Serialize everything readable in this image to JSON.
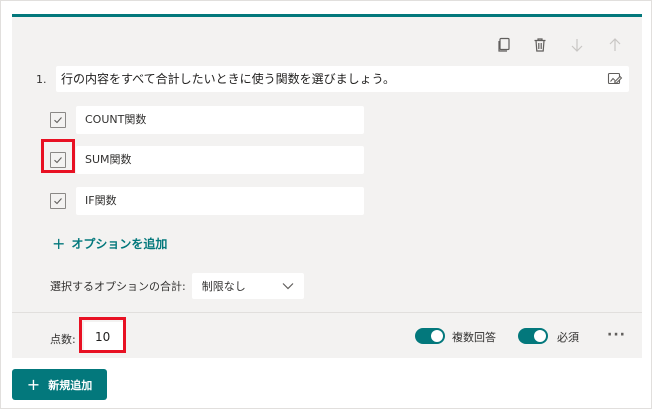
{
  "question": {
    "number": "1.",
    "title": "行の内容をすべて合計したいときに使う関数を選びましょう。"
  },
  "options": [
    {
      "label": "COUNT関数",
      "checked": true
    },
    {
      "label": "SUM関数",
      "checked": true
    },
    {
      "label": "IF関数",
      "checked": true
    }
  ],
  "add_option": {
    "label": "オプションを追加",
    "icon": "plus-icon"
  },
  "selection_total": {
    "label": "選択するオプションの合計:",
    "value": "制限なし"
  },
  "footer": {
    "points_label": "点数:",
    "points_value": "10",
    "multiple_answers_label": "複数回答",
    "multiple_answers_on": true,
    "required_label": "必須",
    "required_on": true,
    "more_icon": "more-icon"
  },
  "new_button": {
    "label": "新規追加",
    "icon": "plus-icon"
  },
  "toolbar_icons": [
    "copy-icon",
    "trash-icon",
    "arrow-down-icon",
    "arrow-up-icon"
  ],
  "colors": {
    "accent": "#03787c",
    "highlight": "#e81123",
    "card_bg": "#f3f2f1"
  }
}
